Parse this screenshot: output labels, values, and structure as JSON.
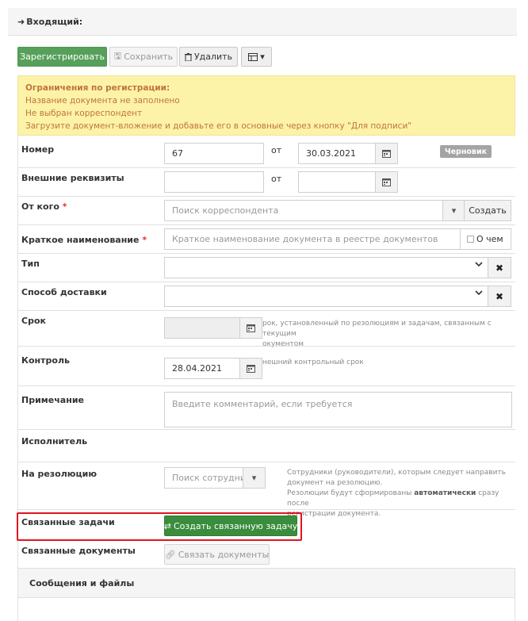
{
  "panel": {
    "title": "Входящий:"
  },
  "toolbar": {
    "register_label": "Зарегистрировать",
    "save_label": "Сохранить",
    "delete_label": "Удалить"
  },
  "warning": {
    "title": "Ограничения по регистрации:",
    "lines": [
      "Название документа не заполнено",
      "Не выбран корреспондент",
      "Загрузите документ-вложение и добавьте его в основные через кнопку \"Для подписи\""
    ]
  },
  "form": {
    "number": {
      "label": "Номер",
      "value": "67",
      "date_sep": "от",
      "date": "30.03.2021",
      "status_badge": "Черновик"
    },
    "external": {
      "label": "Внешние реквизиты",
      "value": "",
      "date_sep": "от",
      "date": ""
    },
    "from": {
      "label": "От кого",
      "required_mark": "*",
      "placeholder": "Поиск корреспондента",
      "create_label": "Создать"
    },
    "short_name": {
      "label": "Краткое наименование",
      "required_mark": "*",
      "placeholder": "Краткое наименование документа в реестре документов",
      "checkbox_label": "О чем"
    },
    "type": {
      "label": "Тип",
      "value": ""
    },
    "delivery": {
      "label": "Способ доставки",
      "value": ""
    },
    "deadline": {
      "label": "Срок",
      "value": "",
      "hint": "Срок, установленный по резолюциям и задачам, связанным с текущим документом",
      "hint_visible": "рок, установленный по резолюциям и задачам, связанным с текущим\nокументом"
    },
    "control": {
      "label": "Контроль",
      "value": "28.04.2021",
      "hint_visible": "нешний контрольный срок"
    },
    "note": {
      "label": "Примечание",
      "placeholder": "Введите комментарий, если требуется"
    },
    "executor": {
      "label": "Исполнитель"
    },
    "resolution": {
      "label": "На резолюцию",
      "placeholder": "Поиск сотрудни",
      "hint_line1": "Сотрудники (руководители), которым следует направить",
      "hint_line2": "документ на резолюцию.",
      "hint_line3_a": "Резолюции будут сформированы ",
      "hint_line3_b": "автоматически",
      "hint_line3_c": " сразу после",
      "hint_line4": "регистрации документа."
    },
    "related_tasks": {
      "label": "Связанные задачи",
      "button_label": "Создать связанную задачу"
    },
    "related_docs": {
      "label": "Связанные документы",
      "button_label": "Связать документы"
    }
  },
  "messages": {
    "title": "Сообщения и файлы"
  },
  "colors": {
    "primary_green": "#57a05a",
    "dark_green": "#3a8d3c",
    "warning_bg": "#fcf3a8",
    "warning_text": "#c0753a",
    "highlight_red": "#e0141e"
  },
  "icons": [
    "sign-in-icon",
    "save-icon",
    "trash-icon",
    "table-icon",
    "caret-down-icon",
    "calendar-icon",
    "close-icon",
    "chevron-down-icon",
    "exchange-icon",
    "link-icon"
  ]
}
